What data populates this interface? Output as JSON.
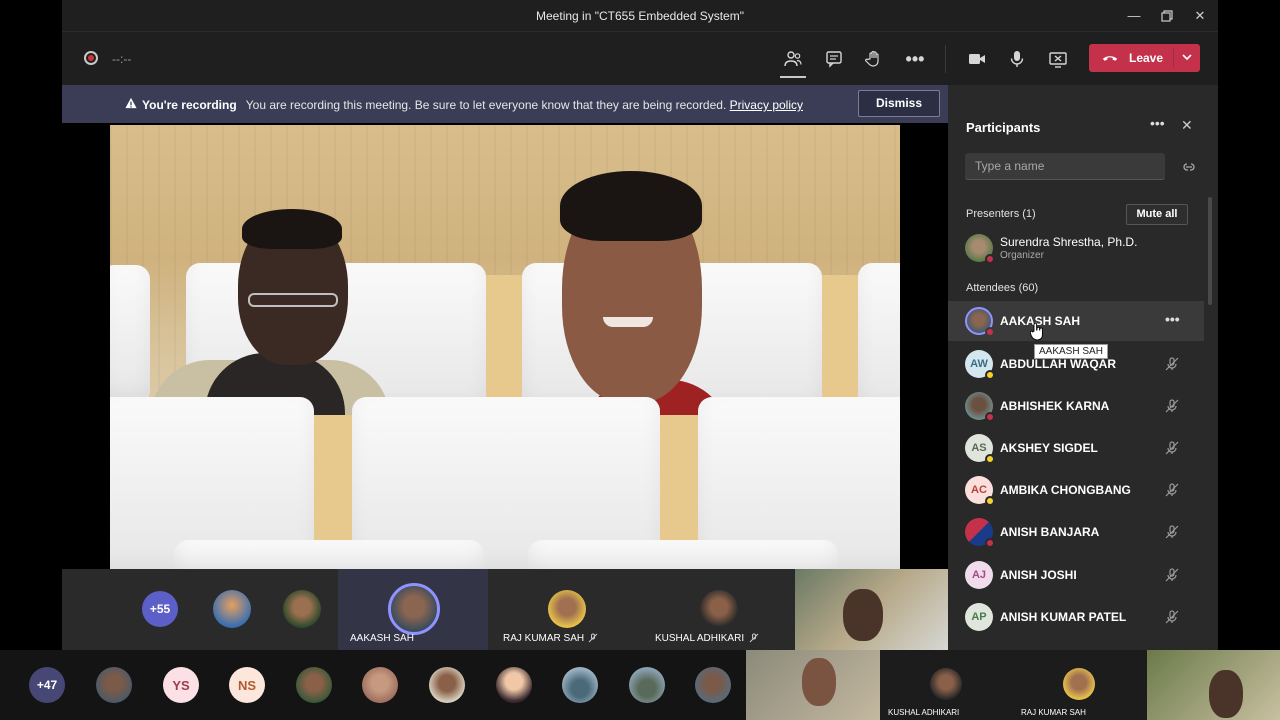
{
  "window": {
    "title": "Meeting in \"CT655 Embedded System\""
  },
  "toolbar": {
    "timer": "--:--",
    "leave_label": "Leave"
  },
  "banner": {
    "bold": "You're recording",
    "message": "You are recording this meeting. Be sure to let everyone know that they are being recorded.",
    "link": "Privacy policy",
    "dismiss_label": "Dismiss"
  },
  "participants_panel": {
    "title": "Participants",
    "search_placeholder": "Type a name",
    "presenters_header": "Presenters (1)",
    "mute_all_label": "Mute all",
    "attendees_header": "Attendees (60)",
    "presenters": [
      {
        "name": "Surendra Shrestha, Ph.D.",
        "role": "Organizer"
      }
    ],
    "attendees": [
      {
        "name": "AAKASH SAH",
        "initials": ""
      },
      {
        "name": "ABDULLAH WAQAR",
        "initials": "AW"
      },
      {
        "name": "ABHISHEK KARNA",
        "initials": ""
      },
      {
        "name": "AKSHEY SIGDEL",
        "initials": "AS"
      },
      {
        "name": "AMBIKA CHONGBANG",
        "initials": "AC"
      },
      {
        "name": "ANISH BANJARA",
        "initials": ""
      },
      {
        "name": "ANISH JOSHI",
        "initials": "AJ"
      },
      {
        "name": "ANISH KUMAR PATEL",
        "initials": "AP"
      }
    ],
    "tooltip": "AAKASH SAH"
  },
  "strip": {
    "overflow_count": "+55",
    "tiles": [
      {
        "name": "AAKASH SAH"
      },
      {
        "name": "RAJ KUMAR SAH"
      },
      {
        "name": "KUSHAL ADHIKARI"
      }
    ]
  },
  "bottom_strip": {
    "overflow_count": "+47",
    "initials": [
      "YS",
      "NS"
    ],
    "labels": [
      "KUSHAL ADHIKARI",
      "RAJ KUMAR SAH"
    ]
  },
  "colors": {
    "leave": "#c4314b",
    "banner": "#3b3d56",
    "panel": "#292929",
    "record": "#d13438"
  }
}
